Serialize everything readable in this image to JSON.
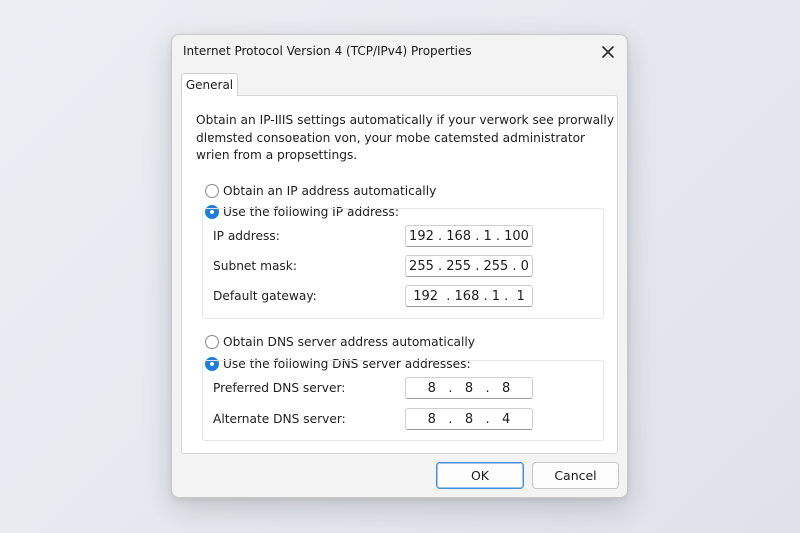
{
  "dialog": {
    "title": "Internet Protocol Version 4 (TCP/IPv4) Properties",
    "close_icon": "close-icon"
  },
  "tabs": [
    {
      "label": "General",
      "selected": true
    }
  ],
  "description": {
    "line1": "Obtain an IP-IIIS settings automatically if your verwork see prorwally",
    "line2": "dlɐmsted consoɐation von, your mobe catemsted administrator",
    "line3": "wrien from a propsettings."
  },
  "ip": {
    "auto_label": "Obtain an IP address automatically",
    "manual_label": "Use the following IP address:",
    "selected": "manual",
    "fields": [
      {
        "label": "IP address:",
        "value": "192 . 168 . 1 . 100"
      },
      {
        "label": "Subnet mask:",
        "value": "255 . 255 . 255 . 0"
      },
      {
        "label": "Default gateway:",
        "value": "192  . 168 . 1 .  1"
      }
    ]
  },
  "dns": {
    "auto_label": "Obtain DNS server address automatically",
    "manual_label": "Use the following DNS server addresses:",
    "selected": "manual",
    "fields": [
      {
        "label": "Preferred DNS server:",
        "value": "8   .   8   .   8"
      },
      {
        "label": "Alternate DNS server:",
        "value": "8   .   8   .   4"
      }
    ]
  },
  "buttons": {
    "ok": "OK",
    "cancel": "Cancel"
  },
  "colors": {
    "accent": "#1f7fd8",
    "dialog_bg": "#f3f3f3",
    "panel_bg": "#ffffff"
  }
}
